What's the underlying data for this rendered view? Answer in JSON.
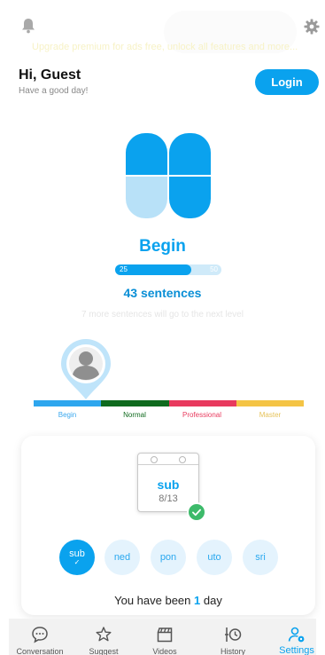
{
  "header": {
    "promo_text": "Upgrade premium for ads free, unlock all features and more..."
  },
  "greeting": {
    "name": "Hi, Guest",
    "subtitle": "Have a good day!",
    "login_label": "Login"
  },
  "level": {
    "name": "Begin",
    "progress_start": "25",
    "progress_end": "50",
    "progress_fraction": 0.72,
    "sentences": "43 sentences",
    "next_level_text": "7 more sentences will go to the next level"
  },
  "level_track": {
    "segments": [
      {
        "label": "Begin",
        "color": "#2ea6ee"
      },
      {
        "label": "Normal",
        "color": "#0f6a1e"
      },
      {
        "label": "Professional",
        "color": "#e83a5e"
      },
      {
        "label": "Master",
        "color": "#f4c445"
      }
    ]
  },
  "calendar": {
    "day": "sub",
    "date": "8/13"
  },
  "week_days": [
    {
      "label": "sub",
      "active": true
    },
    {
      "label": "ned",
      "active": false
    },
    {
      "label": "pon",
      "active": false
    },
    {
      "label": "uto",
      "active": false
    },
    {
      "label": "sri",
      "active": false
    }
  ],
  "streak": {
    "prefix": "You have been",
    "count": "1",
    "suffix": "day"
  },
  "tabs": [
    {
      "label": "Conversation",
      "icon": "chat-bubble-icon",
      "active": false
    },
    {
      "label": "Suggest",
      "icon": "sparkle-star-icon",
      "active": false
    },
    {
      "label": "Videos",
      "icon": "clapperboard-icon",
      "active": false
    },
    {
      "label": "History",
      "icon": "history-clock-icon",
      "active": false
    },
    {
      "label": "Settings",
      "icon": "user-settings-icon",
      "active": true
    }
  ],
  "colors": {
    "accent": "#0aa2ee",
    "accent_light": "#e4f3fd",
    "check_green": "#3dba6a"
  }
}
